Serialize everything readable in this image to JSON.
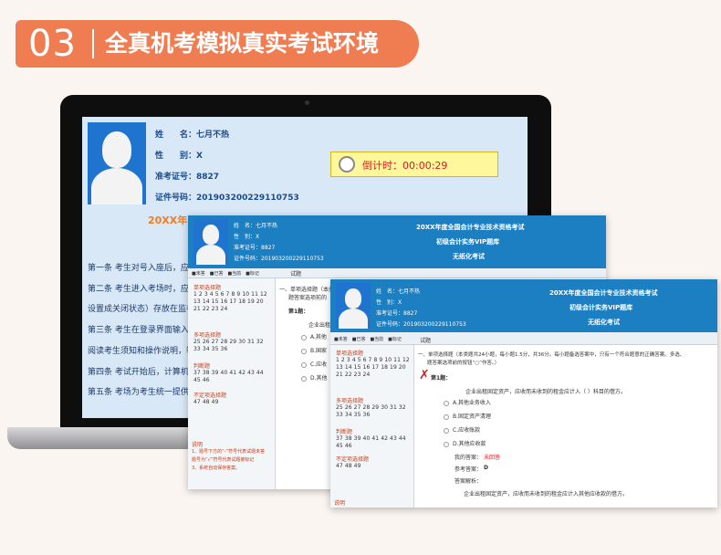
{
  "header": {
    "number": "03",
    "title": "全真机考模拟真实考试环境"
  },
  "laptop": {
    "name_label": "姓　　名：七月不热",
    "gender_label": "性　　别：X",
    "ticket_label": "准考证号：8827",
    "id_label": "证件号码：201903200229110753",
    "timer": "倒计时：00:00:29",
    "title": "20XX年",
    "rules": [
      "第一条 考生对号入座后，应将",
      "第二条 考生进入考场时，应将",
      "设置成关闭状态）存放在监考",
      "第三条 考生在登录界面输入准",
      "阅读考生须知和操作说明，等",
      "第四条 考试开始后，计算机会",
      "第五条 考场为考生统一提供演"
    ]
  },
  "win1": {
    "name": "姓　名：七月不热",
    "gender": "性　别：X",
    "ticket": "准考证号：8827",
    "id": "证件号码：201903200229110753",
    "exam_title": "20XX年度全国会计专业技术资格考试",
    "exam_sub": "初级会计实务VIP题库",
    "exam_mode": "无纸化考试",
    "legend": "■未答　■已答　■当前　■标记",
    "tab": "试题",
    "sections": [
      {
        "name": "单项选择题",
        "nums": "1 2 3 4 5 6 7 8 9 10 11 12 13 14 15 16 17 18 19 20 21 22 23 24"
      },
      {
        "name": "多项选择题",
        "nums": "25 26 27 28 29 30 31 32 33 34 35 36"
      },
      {
        "name": "判断题",
        "nums": "37 38 39 40 41 42 43 44 45 46"
      },
      {
        "name": "不定项选择题",
        "nums": "47 48 49"
      }
    ],
    "q_head": "一、单项选择题（本类题共24小题，",
    "q_sub": "题答案选项前的",
    "q_num": "第1题：",
    "q_text": "企业出租",
    "options": [
      "A.其他",
      "B.国家",
      "C.应收",
      "D.其他"
    ],
    "note_title": "说明",
    "notes": [
      "1、题号下方的“-”符号代表试题未答",
      "题号为“√”符号代表试题被标记",
      "3、系统自动保存答案。"
    ]
  },
  "win2": {
    "name": "姓　名：七月不热",
    "gender": "性　别：X",
    "ticket": "准考证号：8827",
    "id": "证件号码：201903200229110753",
    "exam_title": "20XX年度全国会计专业技术资格考试",
    "exam_sub": "初级会计实务VIP题库",
    "exam_mode": "无纸化考试",
    "legend": "■未答　■已答　■当前　■标记",
    "tab": "试题",
    "sections": [
      {
        "name": "单项选择题",
        "nums": "1 2 3 4 5 6 7 8 9 10 11 12 13 14 15 16 17 18 19 20 21 22 23 24"
      },
      {
        "name": "多项选择题",
        "nums": "25 26 27 28 29 30 31 32 33 34 35 36"
      },
      {
        "name": "判断题",
        "nums": "37 38 39 40 41 42 43 44 45 46"
      },
      {
        "name": "不定项选择题",
        "nums": "47 48 49"
      }
    ],
    "q_head": "一、单项选择题（本类题共24小题，每小题1.5分，共36分。每小题备选答案中，只有一个符合题意的正确答案。多选、",
    "q_head2": "题答案选项前的按钮“○”作答。）",
    "q_num": "第1题：",
    "q_text": "企业出租固定资产，应收而未收到的租金应计入（ ）科目的借方。",
    "options": [
      "A.其他业务收入",
      "B.固定资产清理",
      "C.应收账款",
      "D.其他应收款"
    ],
    "my_answer_label": "我的答案：",
    "my_answer": "未回答",
    "ref_answer_label": "参考答案：",
    "ref_answer": "D",
    "analysis_label": "答案解析：",
    "analysis": "企业出租固定资产，应收而未收到的租金应计入其他应收款的借方。",
    "footer": "说明"
  },
  "colors": {
    "accent": "#f07d52",
    "blue": "#1c7fc1",
    "red": "#d71c1c"
  }
}
